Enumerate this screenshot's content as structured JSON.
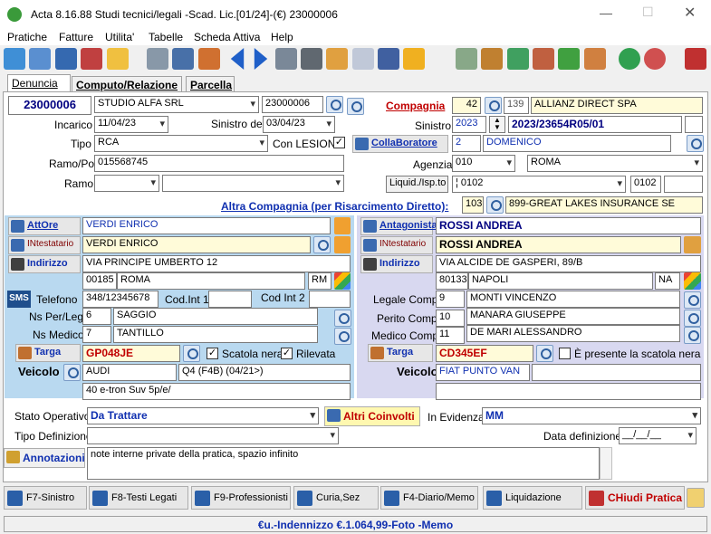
{
  "window": {
    "title": "Acta 8.16.88 Studi tecnici/legali -Scad. Lic.[01/24]-(€) 23000006"
  },
  "menu": [
    "Pratiche",
    "Fatture",
    "Utilita'",
    "Tabelle",
    "Scheda Attiva",
    "Help"
  ],
  "tabs": [
    "Denuncia",
    "Computo/Relazione",
    "Parcella"
  ],
  "practice": {
    "number": "23000006",
    "studio": "STUDIO ALFA SRL",
    "code": "23000006"
  },
  "incarico": {
    "label": "Incarico",
    "value": "11/04/23"
  },
  "sinistro_del": {
    "label": "Sinistro del",
    "value": "03/04/23"
  },
  "tipo": {
    "label": "Tipo",
    "value": "RCA"
  },
  "con_lesioni": {
    "label": "Con LESIONI",
    "checked": "✓"
  },
  "ramo_pol": {
    "label": "Ramo/Pol",
    "value": "015568745"
  },
  "ramo": {
    "label": "Ramo"
  },
  "compagnia": {
    "label": "Compagnia",
    "code": "42",
    "id": "139",
    "name": "ALLIANZ DIRECT SPA"
  },
  "sinistro": {
    "label": "Sinistro",
    "year": "2023",
    "number": "2023/23654R05/01"
  },
  "collaboratore": {
    "label": "CollaBoratore",
    "code": "2",
    "name": "DOMENICO"
  },
  "agenzia": {
    "label": "Agenzia",
    "code": "010",
    "name": "ROMA"
  },
  "liquid": {
    "label": "Liquid./Isp.to",
    "value": "¦ 0102",
    "code": "0102"
  },
  "altra_compagnia": {
    "label": "Altra Compagnia (per Risarcimento Diretto):",
    "code": "103",
    "name": "899-GREAT LAKES INSURANCE SE"
  },
  "left": {
    "attore": {
      "label": "AttOre",
      "value": "VERDI ENRICO"
    },
    "intestatario": {
      "label": "INtestatario",
      "value": "VERDI ENRICO"
    },
    "indirizzo": {
      "label": "Indirizzo",
      "value": "VIA PRINCIPE UMBERTO 12"
    },
    "cap": "00185",
    "citta": "ROMA",
    "prov": "RM",
    "sms": "SMS",
    "telefono": {
      "label": "Telefono",
      "value": "348/12345678"
    },
    "cod_int1": "Cod.Int 1",
    "cod_int2": "Cod Int 2",
    "ns_per_leg": {
      "label": "Ns Per/Leg",
      "code": "6",
      "name": "SAGGIO"
    },
    "ns_medico": {
      "label": "Ns Medico",
      "code": "7",
      "name": "TANTILLO"
    },
    "targa": {
      "label": "Targa",
      "value": "GP048JE"
    },
    "scatola_nera": {
      "label": "Scatola nera",
      "checked": "✓"
    },
    "rilevata": {
      "label": "Rilevata",
      "checked": "✓"
    },
    "veicolo": {
      "label": "Veicolo",
      "make": "AUDI",
      "model": "Q4 (F4B)  (04/21>)",
      "desc": "40 e-tron Suv 5p/e/"
    }
  },
  "right": {
    "antagonista": {
      "label": "Antagonista",
      "value": "ROSSI ANDREA"
    },
    "intestatario": {
      "label": "INtestatario",
      "value": "ROSSI ANDREA"
    },
    "indirizzo": {
      "label": "Indirizzo",
      "value": "VIA ALCIDE DE GASPERI, 89/B"
    },
    "cap": "80133",
    "citta": "NAPOLI",
    "prov": "NA",
    "legale": {
      "label": "Legale Comp.",
      "code": "9",
      "name": "MONTI VINCENZO"
    },
    "perito": {
      "label": "Perito Comp.",
      "code": "10",
      "name": "MANARA GIUSEPPE"
    },
    "medico": {
      "label": "Medico Comp.",
      "code": "11",
      "name": "DE MARI ALESSANDRO"
    },
    "targa": {
      "label": "Targa",
      "value": "CD345EF"
    },
    "scatola": {
      "label": "È presente la scatola nera"
    },
    "veicolo": {
      "label": "Veicolo",
      "value": "FIAT PUNTO VAN"
    }
  },
  "stato": {
    "label": "Stato Operativo",
    "value": "Da Trattare"
  },
  "altri_coinvolti": "Altri Coinvolti",
  "in_evidenza": {
    "label": "In Evidenza",
    "value": "MM"
  },
  "tipo_definizione": {
    "label": "Tipo Definizione"
  },
  "data_definizione": {
    "label": "Data definizione",
    "value": "__/__/__"
  },
  "annotazioni": {
    "label": "Annotazioni",
    "value": "note interne private della pratica, spazio infinito"
  },
  "footer": [
    "F7-Sinistro",
    "F8-Testi Legati",
    "F9-Professionisti",
    "Curia,Sez",
    "F4-Diario/Memo",
    "Liquidazione"
  ],
  "chiudi": "CHiudi Pratica",
  "status": "€u.-Indennizzo €.1.064,99-Foto -Memo"
}
